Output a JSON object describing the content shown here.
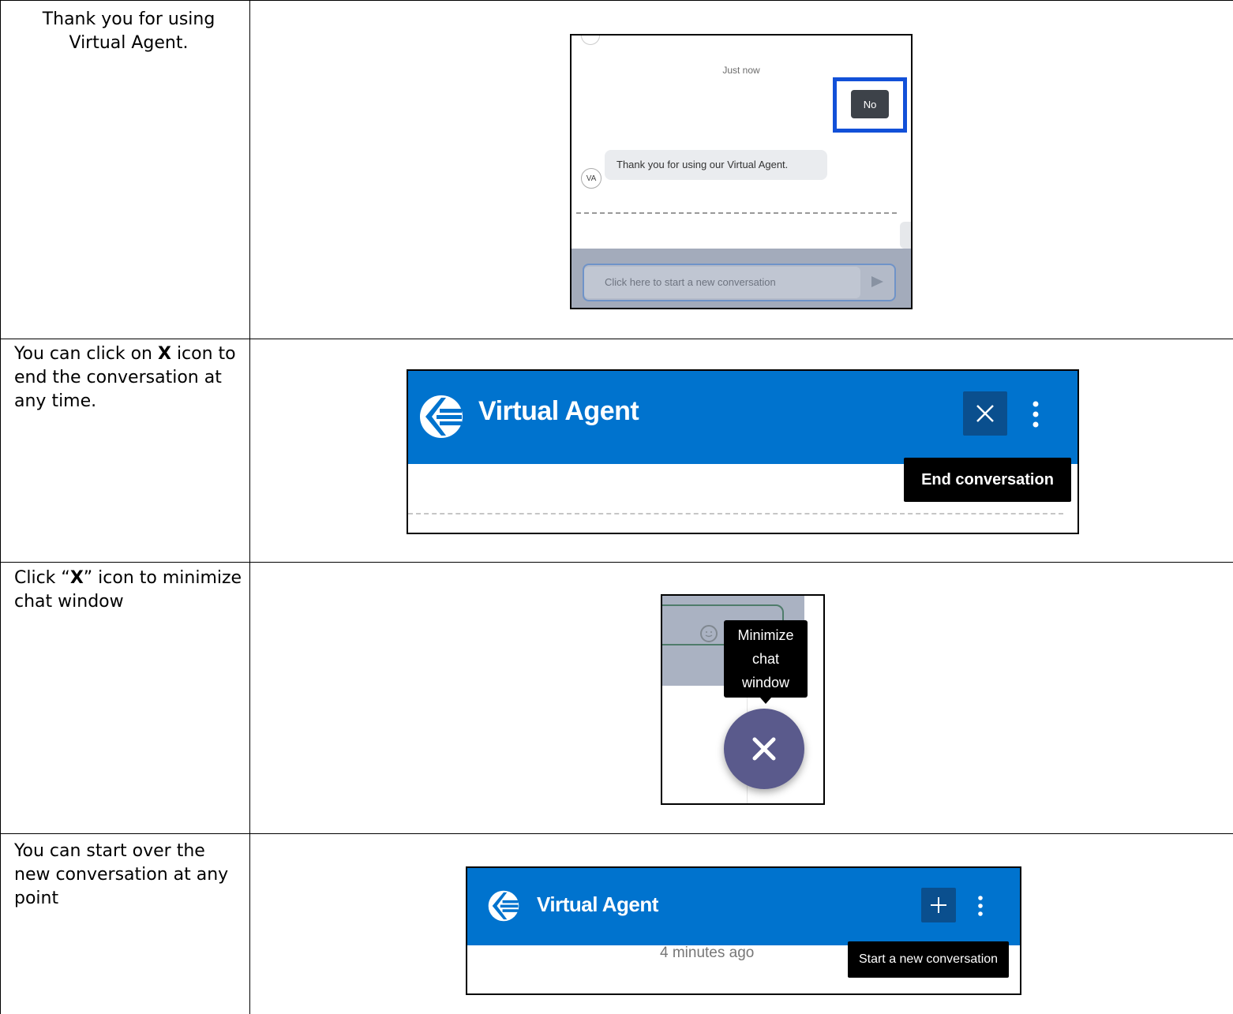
{
  "rows": [
    {
      "instruction": "Thank you for using Virtual Agent.",
      "screenshot": {
        "timestamp": "Just now",
        "user_reply": "No",
        "agent_message": "Thank you for using our Virtual Agent.",
        "agent_avatar": "VA",
        "input_placeholder": "Click here to start a new conversation",
        "highlight_color": "#1250d8"
      }
    },
    {
      "instruction_parts": [
        "You can click on ",
        "X",
        " icon to end the conversation at any time."
      ],
      "screenshot": {
        "title": "Virtual Agent",
        "tooltip": "End conversation",
        "header_color": "#0073ce"
      }
    },
    {
      "instruction_parts": [
        "Click “",
        "X",
        "” icon to minimize chat window"
      ],
      "screenshot": {
        "tooltip_lines": [
          "Minimize",
          "chat",
          "window"
        ],
        "fab_color": "#5a5a8c"
      }
    },
    {
      "instruction": "You can start over the new conversation at any point",
      "screenshot": {
        "title": "Virtual Agent",
        "timestamp": "4 minutes ago",
        "tooltip": "Start a new conversation"
      }
    }
  ],
  "icons": [
    "send-icon",
    "close-icon",
    "more-vertical-icon",
    "smiley-icon",
    "plus-icon",
    "virtual-agent-logo-icon"
  ]
}
